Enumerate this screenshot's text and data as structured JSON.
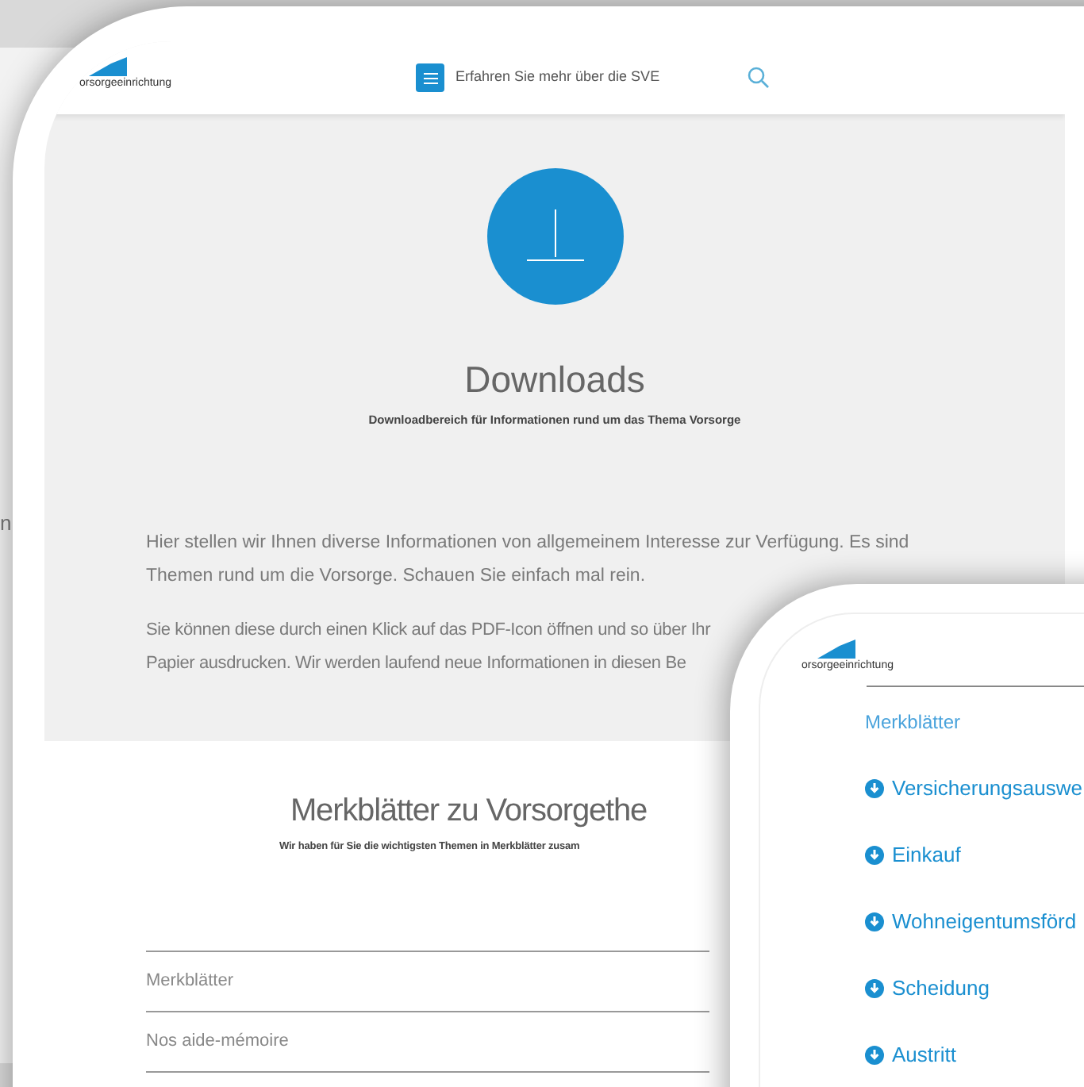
{
  "back_device": {
    "text": "n"
  },
  "tablet": {
    "header": {
      "logo_text": "orsorgeeinrichtung",
      "menu_label": "Erfahren Sie mehr über die SVE"
    },
    "hero": {
      "title": "Downloads",
      "subtitle": "Downloadbereich für Informationen rund um das Thema Vorsorge"
    },
    "paragraphs": [
      "Hier stellen wir Ihnen diverse Informationen von allgemeinem Interesse zur Verfügung. Es sind Themen rund um die Vorsorge. Schauen Sie einfach mal rein.",
      "Sie können diese durch einen Klick auf das PDF-Icon öffnen und so über Ihr",
      "Papier ausdrucken. Wir werden laufend neue Informationen in diesen Be"
    ],
    "section": {
      "title": "Merkblätter zu Vorsorgethe",
      "subtitle": "Wir haben für Sie die wichtigsten Themen in Merkblätter zusam",
      "rows": [
        "Merkblätter",
        "Nos aide-mémoire"
      ]
    }
  },
  "phone": {
    "logo_text": "orsorgeeinrichtung",
    "heading": "Merkblätter",
    "items": [
      "Versicherungsauswe",
      "Einkauf",
      "Wohneigentumsförd",
      "Scheidung",
      "Austritt"
    ]
  }
}
